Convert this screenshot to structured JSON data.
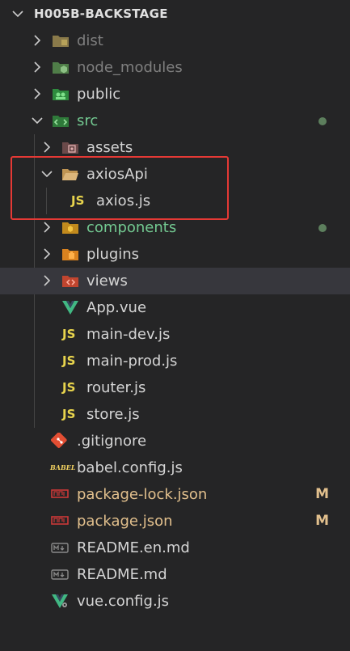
{
  "explorer": {
    "title": "H005B-BACKSTAGE",
    "accent": {
      "highlight_box": "#e53935",
      "modified": "#e2c08d",
      "untracked": "#73c991"
    },
    "items": [
      {
        "label": "dist",
        "icon": "dist-folder-icon",
        "expandable": true,
        "expanded": false,
        "style": "dim"
      },
      {
        "label": "node_modules",
        "icon": "node-modules-folder-icon",
        "expandable": true,
        "expanded": false,
        "style": "dim"
      },
      {
        "label": "public",
        "icon": "public-folder-icon",
        "expandable": true,
        "expanded": false,
        "style": "normal"
      },
      {
        "label": "src",
        "icon": "src-folder-icon",
        "expandable": true,
        "expanded": true,
        "style": "green",
        "status_dot": true
      },
      {
        "label": "assets",
        "icon": "assets-folder-icon",
        "expandable": true,
        "expanded": false,
        "style": "normal"
      },
      {
        "label": "axiosApi",
        "icon": "folder-open-icon",
        "expandable": true,
        "expanded": true,
        "style": "normal"
      },
      {
        "label": "axios.js",
        "icon": "js-file-icon",
        "icon_text": "JS",
        "style": "normal"
      },
      {
        "label": "components",
        "icon": "components-folder-icon",
        "expandable": true,
        "expanded": false,
        "style": "green",
        "status_dot": true
      },
      {
        "label": "plugins",
        "icon": "plugins-folder-icon",
        "expandable": true,
        "expanded": false,
        "style": "normal"
      },
      {
        "label": "views",
        "icon": "views-folder-icon",
        "expandable": true,
        "expanded": false,
        "style": "normal",
        "selected": true
      },
      {
        "label": "App.vue",
        "icon": "vue-file-icon",
        "style": "normal"
      },
      {
        "label": "main-dev.js",
        "icon": "js-file-icon",
        "icon_text": "JS",
        "style": "normal"
      },
      {
        "label": "main-prod.js",
        "icon": "js-file-icon",
        "icon_text": "JS",
        "style": "normal"
      },
      {
        "label": "router.js",
        "icon": "js-file-icon",
        "icon_text": "JS",
        "style": "normal"
      },
      {
        "label": "store.js",
        "icon": "js-file-icon",
        "icon_text": "JS",
        "style": "normal"
      },
      {
        "label": ".gitignore",
        "icon": "git-file-icon",
        "style": "normal"
      },
      {
        "label": "babel.config.js",
        "icon": "babel-file-icon",
        "icon_text": "BABEL",
        "style": "normal"
      },
      {
        "label": "package-lock.json",
        "icon": "npm-file-icon",
        "style": "modified",
        "status": "M"
      },
      {
        "label": "package.json",
        "icon": "npm-file-icon",
        "style": "modified",
        "status": "M"
      },
      {
        "label": "README.en.md",
        "icon": "markdown-file-icon",
        "style": "normal"
      },
      {
        "label": "README.md",
        "icon": "markdown-file-icon",
        "style": "normal"
      },
      {
        "label": "vue.config.js",
        "icon": "vue-config-file-icon",
        "style": "normal"
      }
    ]
  }
}
